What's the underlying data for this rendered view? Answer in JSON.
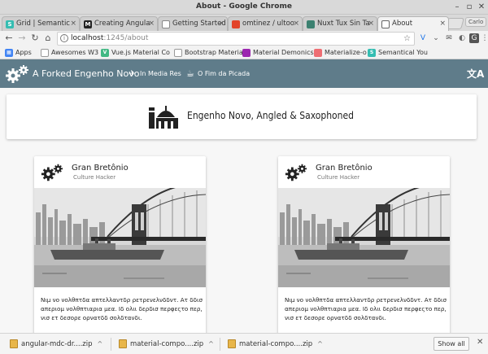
{
  "window": {
    "title": "About - Google Chrome"
  },
  "tabs": [
    {
      "label": "Grid | Semantic",
      "favicon": "S",
      "color": "#35bdb2"
    },
    {
      "label": "Creating Angula",
      "favicon": "M",
      "color": "#222222"
    },
    {
      "label": "Getting Started",
      "favicon": "",
      "color": "#ffffff"
    },
    {
      "label": "omtinez / ultoo",
      "favicon": "",
      "color": "#e24329"
    },
    {
      "label": "Nuxt Tux Sin Ta",
      "favicon": "",
      "color": "#3b8070"
    },
    {
      "label": "About",
      "favicon": "",
      "color": "#ffffff"
    }
  ],
  "profile": {
    "label": "Carlo"
  },
  "omnibox": {
    "host": "localhost",
    "path": ":1245/about"
  },
  "bookmarks": [
    {
      "label": "Apps",
      "color": "#4285f4"
    },
    {
      "label": "Awesomes W3",
      "color": "#ffffff"
    },
    {
      "label": "Vue.js Material Co",
      "color": "#41b883"
    },
    {
      "label": "Bootstrap Material",
      "color": "#ffffff"
    },
    {
      "label": "Material Demonics",
      "color": "#9c27b0"
    },
    {
      "label": "Materialize-o",
      "color": "#ee6e73"
    },
    {
      "label": "Semantical You",
      "color": "#35bdb2"
    }
  ],
  "appbar": {
    "title": "A Forked Engenho Novo",
    "links": [
      "In Media Res",
      "O Fim da Picada"
    ],
    "bg": "#5f7c8a"
  },
  "banner": {
    "title": "Engenho Novo, Angled & Saxophoned"
  },
  "cards": [
    {
      "title": "Gran Bretônio",
      "subtitle": "Culture Hacker",
      "text": "Νιμ νο νολθπτδα απτελλαντδρ ρετρενελνδδντ. Ατ δδισ απεριομ νολθπτιαρια μεα. Ιδ ολιι δερδισ περφεςτο περ, νισ ετ δεσορε ορνατδδ σολδτανδι."
    },
    {
      "title": "Gran Bretônio",
      "subtitle": "Culture Hacker",
      "text": "Νιμ νο νολθπτδα απτελλαντδρ ρετρενελνδδντ. Ατ δδισ απεριομ νολθπτιαρια μεα. Ιδ ολιι δερδισ περφεςτο περ, νισ ετ δεσορε ορνατδδ σολδτανδι."
    }
  ],
  "downloads": {
    "items": [
      "angular-mdc-dr....zip",
      "material-compo....zip",
      "material-compo....zip"
    ],
    "show_all": "Show all"
  }
}
